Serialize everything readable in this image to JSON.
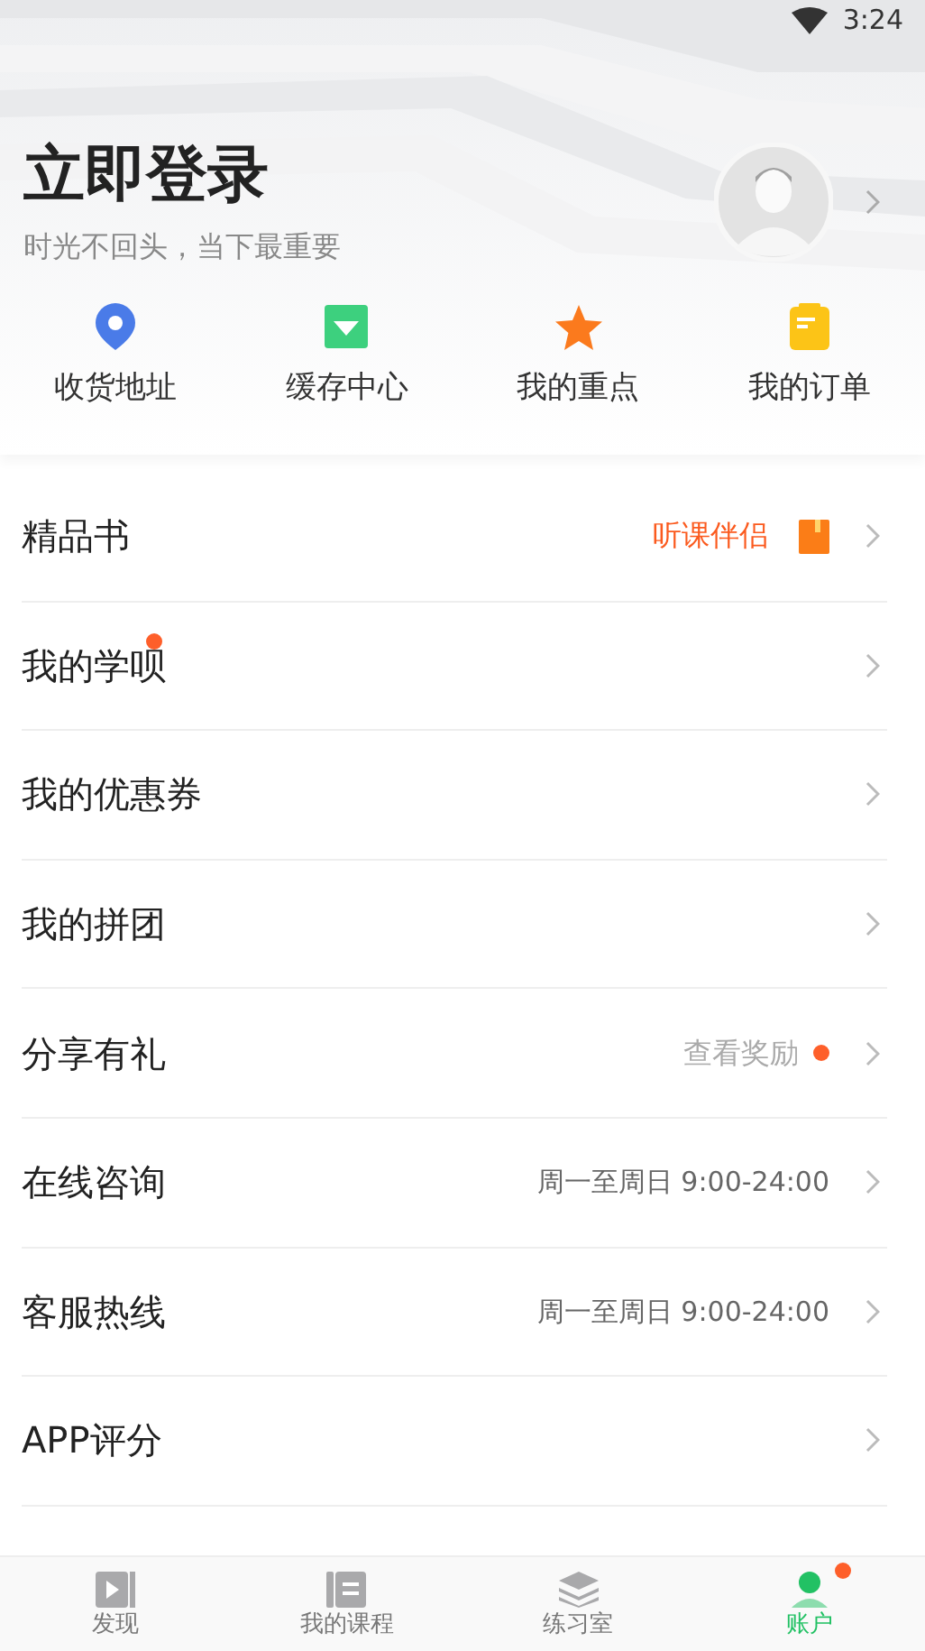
{
  "status_bar": {
    "time": "3:24"
  },
  "header": {
    "title": "立即登录",
    "subtitle": "时光不回头，当下最重要"
  },
  "shortcuts": [
    {
      "label": "收货地址",
      "kind": "pin"
    },
    {
      "label": "缓存中心",
      "kind": "download"
    },
    {
      "label": "我的重点",
      "kind": "star"
    },
    {
      "label": "我的订单",
      "kind": "order"
    }
  ],
  "menu": [
    {
      "kind": "accent",
      "label": "精品书",
      "badge": false,
      "detail": "听课伴侣",
      "detail_badge": false
    },
    {
      "kind": "simple",
      "label": "我的学呗",
      "badge": true
    },
    {
      "kind": "simple",
      "label": "我的优惠券",
      "badge": false
    },
    {
      "kind": "simple",
      "label": "我的拼团",
      "badge": false
    },
    {
      "kind": "muted",
      "label": "分享有礼",
      "badge": false,
      "detail": "查看奖励",
      "detail_badge": true
    },
    {
      "kind": "plain",
      "label": "在线咨询",
      "badge": false,
      "detail": "周一至周日 9:00-24:00",
      "detail_badge": false
    },
    {
      "kind": "plain",
      "label": "客服热线",
      "badge": false,
      "detail": "周一至周日 9:00-24:00",
      "detail_badge": false
    },
    {
      "kind": "simple",
      "label": "APP评分",
      "badge": false
    }
  ],
  "tab_bar": [
    {
      "label": "发现",
      "kind": "discover",
      "selected": false,
      "badge": false
    },
    {
      "label": "我的课程",
      "kind": "courses",
      "selected": false,
      "badge": false
    },
    {
      "label": "练习室",
      "kind": "practice",
      "selected": false,
      "badge": false
    },
    {
      "label": "账户",
      "kind": "account",
      "selected": true,
      "badge": true
    }
  ]
}
